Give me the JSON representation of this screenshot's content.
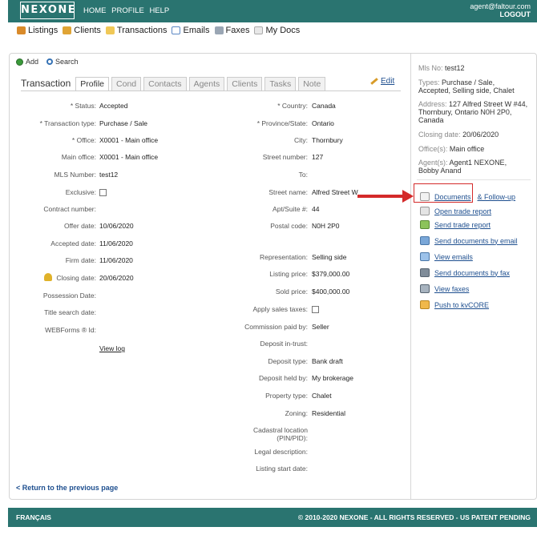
{
  "header": {
    "logo": "NEXONE",
    "nav": [
      "HOME",
      "PROFILE",
      "HELP"
    ],
    "account_email": "agent@faltour.com",
    "logout": "LOGOUT"
  },
  "subnav": [
    {
      "label": "Listings",
      "icon": "house-icon"
    },
    {
      "label": "Clients",
      "icon": "clients-icon"
    },
    {
      "label": "Transactions",
      "icon": "folder-icon"
    },
    {
      "label": "Emails",
      "icon": "envelope-icon"
    },
    {
      "label": "Faxes",
      "icon": "fax-icon"
    },
    {
      "label": "My Docs",
      "icon": "docs-icon"
    }
  ],
  "toolbar": {
    "add": "Add",
    "search": "Search"
  },
  "tabs": {
    "title": "Transaction",
    "items": [
      "Profile",
      "Cond",
      "Contacts",
      "Agents",
      "Clients",
      "Tasks",
      "Note"
    ],
    "edit": "Edit"
  },
  "form_left": [
    {
      "label": "* Status:",
      "value": "Accepted"
    },
    {
      "label": "* Transaction type:",
      "value": "Purchase / Sale"
    },
    {
      "label": "* Office:",
      "value": "X0001 - Main office"
    },
    {
      "label": "Main office:",
      "value": "X0001 - Main office"
    },
    {
      "label": "MLS Number:",
      "value": "test12"
    },
    {
      "label": "Exclusive:",
      "value": ""
    },
    {
      "label": "Contract number:",
      "value": ""
    },
    {
      "label": "Offer date:",
      "value": "10/06/2020"
    },
    {
      "label": "Accepted date:",
      "value": "11/06/2020"
    },
    {
      "label": "Firm date:",
      "value": "11/06/2020"
    },
    {
      "label": "Closing date:",
      "value": "20/06/2020"
    },
    {
      "label": "Possession Date:",
      "value": ""
    },
    {
      "label": "Title search date:",
      "value": ""
    },
    {
      "label": "WEBForms ® Id:",
      "value": ""
    }
  ],
  "view_log": "View log",
  "form_right": [
    {
      "label": "* Country:",
      "value": "Canada"
    },
    {
      "label": "* Province/State:",
      "value": "Ontario"
    },
    {
      "label": "City:",
      "value": "Thornbury"
    },
    {
      "label": "Street number:",
      "value": "127"
    },
    {
      "label": "To:",
      "value": ""
    },
    {
      "label": "Street name:",
      "value": "Alfred Street W"
    },
    {
      "label": "Apt/Suite #:",
      "value": "44"
    },
    {
      "label": "Postal code:",
      "value": "N0H 2P0"
    },
    {
      "label": "Representation:",
      "value": "Selling side"
    },
    {
      "label": "Listing price:",
      "value": "$379,000.00"
    },
    {
      "label": "Sold price:",
      "value": "$400,000.00"
    },
    {
      "label": "Apply sales taxes:",
      "value": ""
    },
    {
      "label": "Commission paid by:",
      "value": "Seller"
    },
    {
      "label": "Deposit in-trust:",
      "value": ""
    },
    {
      "label": "Deposit type:",
      "value": "Bank draft"
    },
    {
      "label": "Deposit held by:",
      "value": "My brokerage"
    },
    {
      "label": "Property type:",
      "value": "Chalet"
    },
    {
      "label": "Zoning:",
      "value": "Residential"
    },
    {
      "label": "Cadastral location",
      "label2": "(PIN/PID):",
      "value": ""
    },
    {
      "label": "Legal description:",
      "value": ""
    },
    {
      "label": "Listing start date:",
      "value": ""
    }
  ],
  "return_link": "< Return to the previous page",
  "summary": {
    "mls_label": "Mls No:",
    "mls": "test12",
    "types_label": "Types:",
    "types_1": "Purchase / Sale,",
    "types_2": "Accepted, Selling side, Chalet",
    "address_label": "Address:",
    "address_1": "127 Alfred Street W #44,",
    "address_2": "Thornbury, Ontario N0H 2P0,",
    "address_3": "Canada",
    "closing_label": "Closing date:",
    "closing": "20/06/2020",
    "offices_label": "Office(s):",
    "offices": "Main office",
    "agents_label": "Agent(s):",
    "agents_1": "Agent1 NEXONE,",
    "agents_2": "Bobby Anand"
  },
  "actions": [
    {
      "label": "Documents",
      "extra": "& Follow-up",
      "icon": "document-icon"
    },
    {
      "label": "Open trade report",
      "icon": "report-icon"
    },
    {
      "label": "Send trade report",
      "icon": "send-report-icon"
    },
    {
      "label": "Send documents by email",
      "icon": "email-docs-icon"
    },
    {
      "label": "View emails",
      "icon": "view-emails-icon"
    },
    {
      "label": "Send documents by fax",
      "icon": "fax-docs-icon"
    },
    {
      "label": "View faxes",
      "icon": "view-faxes-icon"
    },
    {
      "label": "Push to kvCORE",
      "icon": "push-icon"
    }
  ],
  "footer": {
    "language": "FRANÇAIS",
    "copyright": "© 2010-2020 NEXONE - ALL RIGHTS RESERVED - US PATENT PENDING"
  },
  "colors": {
    "brand": "#2a7470",
    "link": "#1e4f8f",
    "highlight": "#d42a2a"
  }
}
